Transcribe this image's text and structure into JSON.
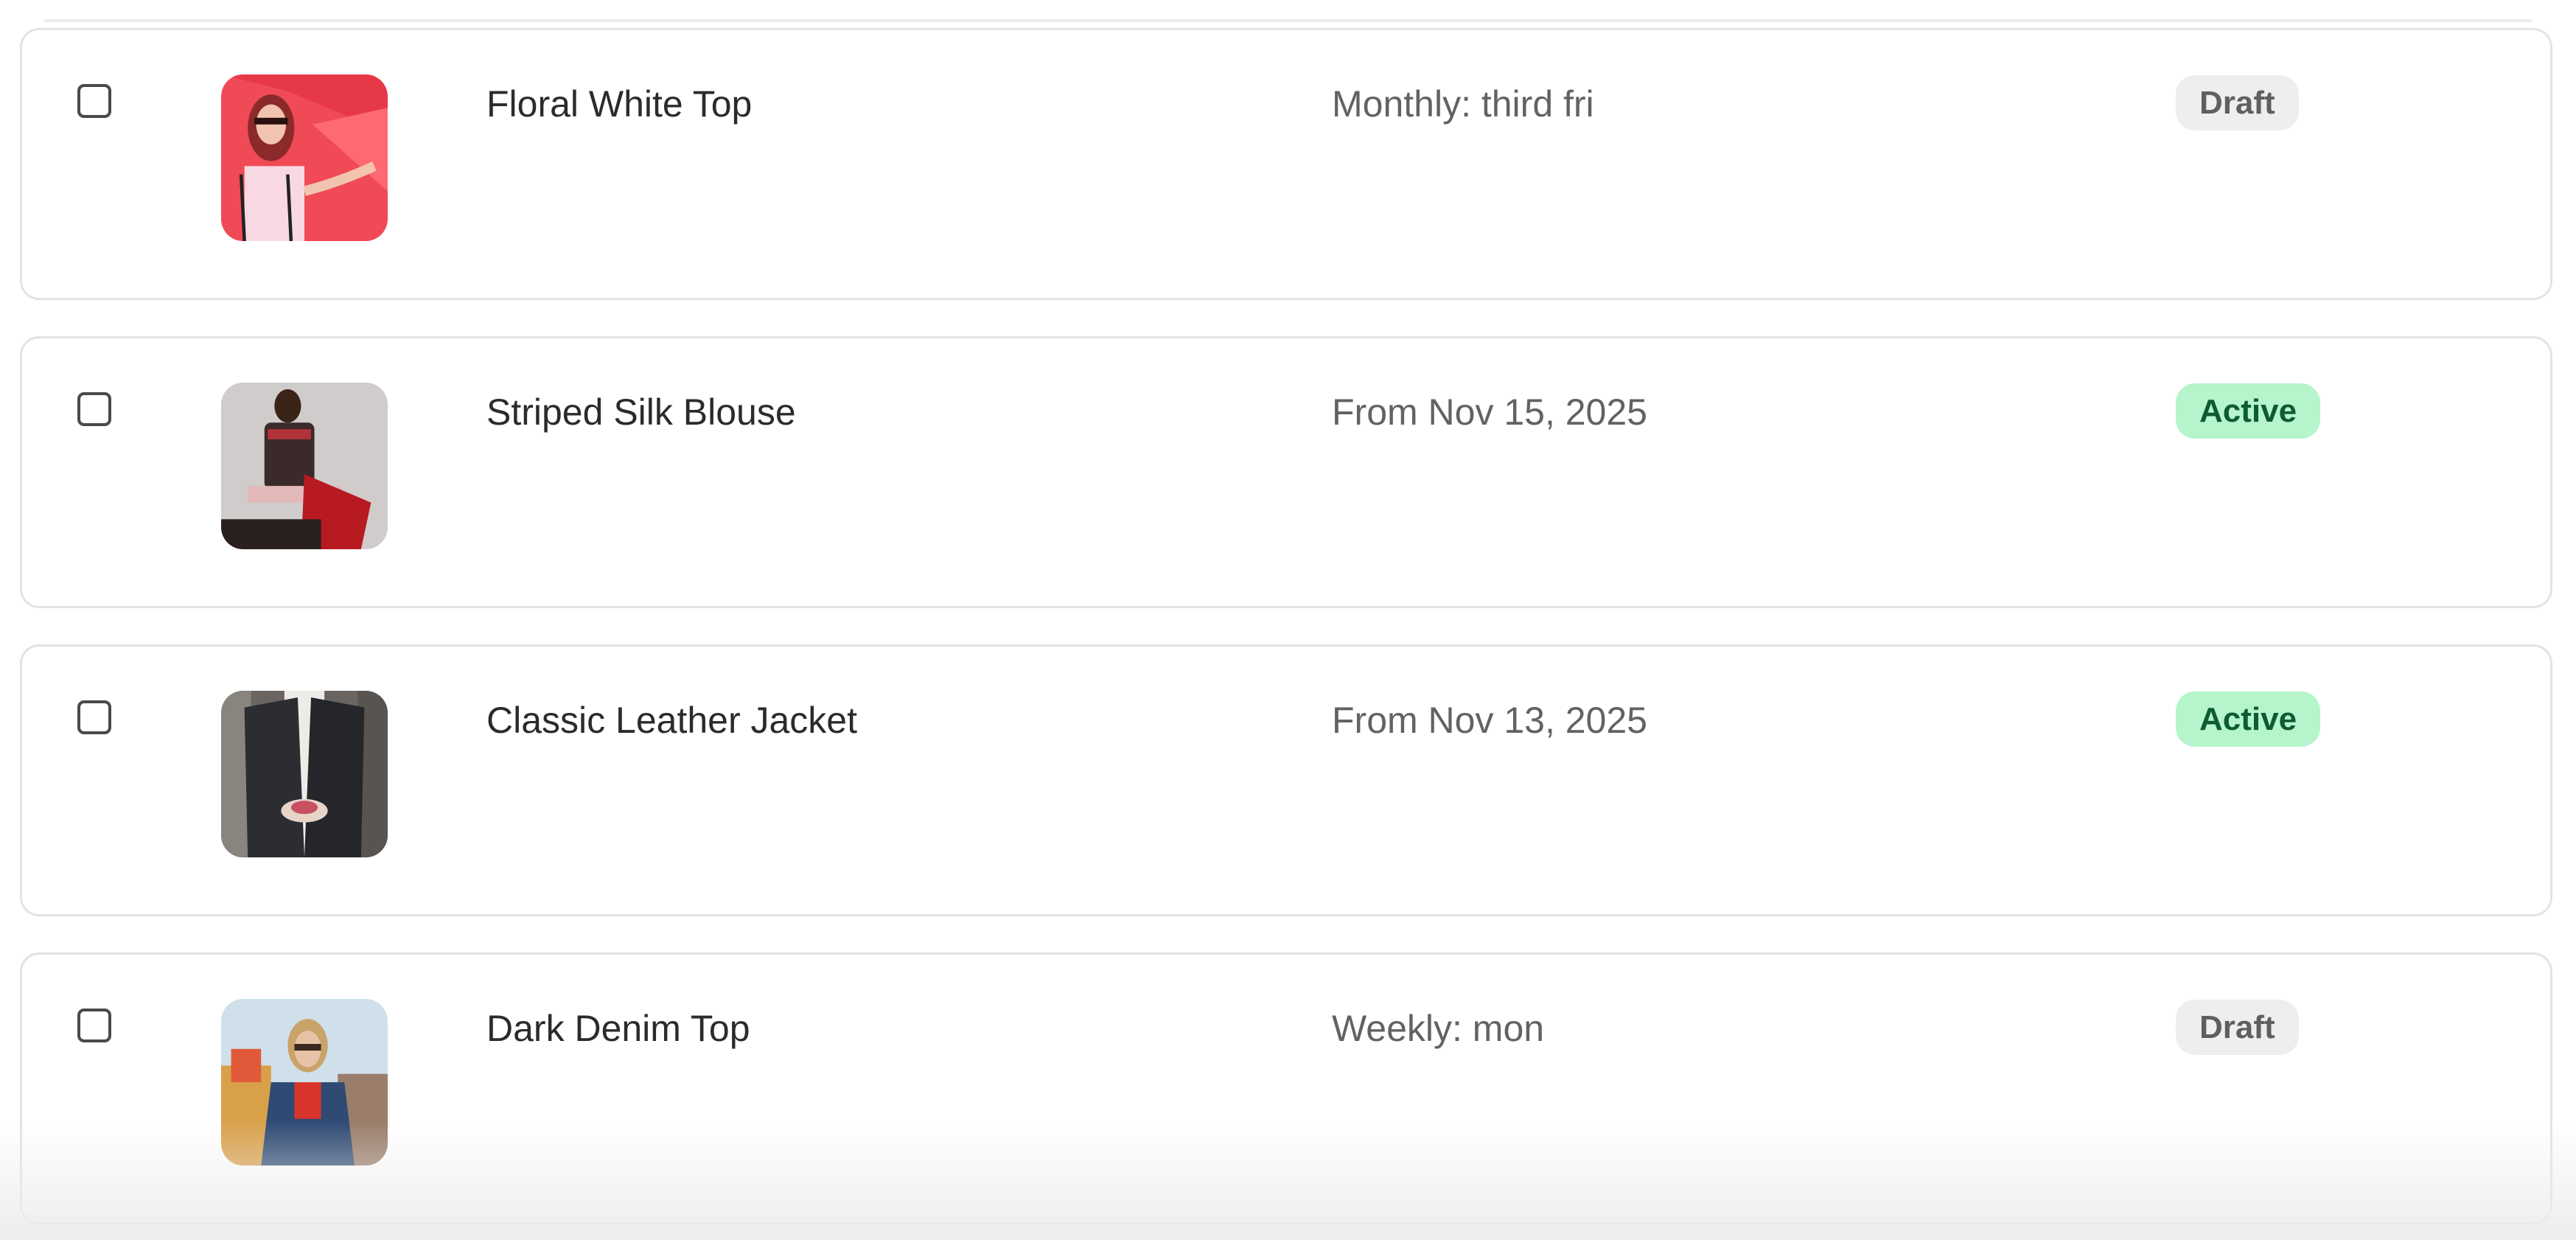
{
  "products": [
    {
      "name": "Floral White Top",
      "schedule": "Monthly: third fri",
      "status": "Draft",
      "image": "woman-red-background-photo"
    },
    {
      "name": "Striped Silk Blouse",
      "schedule": "From Nov 15, 2025",
      "status": "Active",
      "image": "man-seated-dark-photo"
    },
    {
      "name": "Classic Leather Jacket",
      "schedule": "From Nov 13, 2025",
      "status": "Active",
      "image": "leather-jacket-photo"
    },
    {
      "name": "Dark Denim Top",
      "schedule": "Weekly: mon",
      "status": "Draft",
      "image": "denim-jacket-woman-photo"
    }
  ],
  "colors": {
    "active_bg": "#b6f5cc",
    "active_text": "#0e5b32",
    "draft_bg": "#eeeeee",
    "draft_text": "#5f5f5f"
  }
}
